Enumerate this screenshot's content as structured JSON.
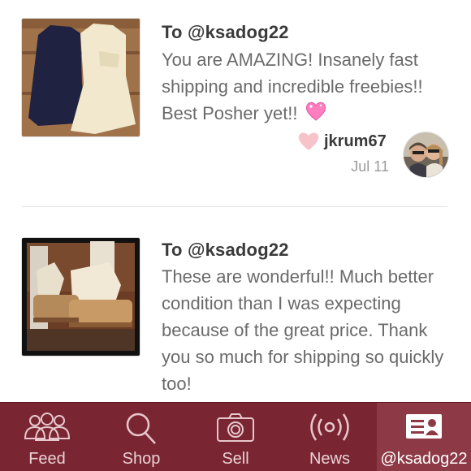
{
  "notes": [
    {
      "to": "To @ksadog22",
      "message": "You are AMAZING! Insanely fast shipping and incredible freebies!! Best Posher yet!!",
      "emoji": "sparkling-heart-icon",
      "sender": "jkrum67",
      "date": "Jul 11"
    },
    {
      "to": "To @ksadog22",
      "message": "These are wonderful!! Much better condition than I was expecting because of the great price. Thank you so much for shipping so quickly too!"
    }
  ],
  "tabs": [
    {
      "label": "Feed",
      "icon": "people-icon"
    },
    {
      "label": "Shop",
      "icon": "search-icon"
    },
    {
      "label": "Sell",
      "icon": "camera-icon"
    },
    {
      "label": "News",
      "icon": "broadcast-icon"
    },
    {
      "label": "@ksadog22",
      "icon": "profile-card-icon"
    }
  ],
  "colors": {
    "tabbar": "#7a2532",
    "tabbar_active": "#8e3a46",
    "heart": "#f6c3c9"
  }
}
